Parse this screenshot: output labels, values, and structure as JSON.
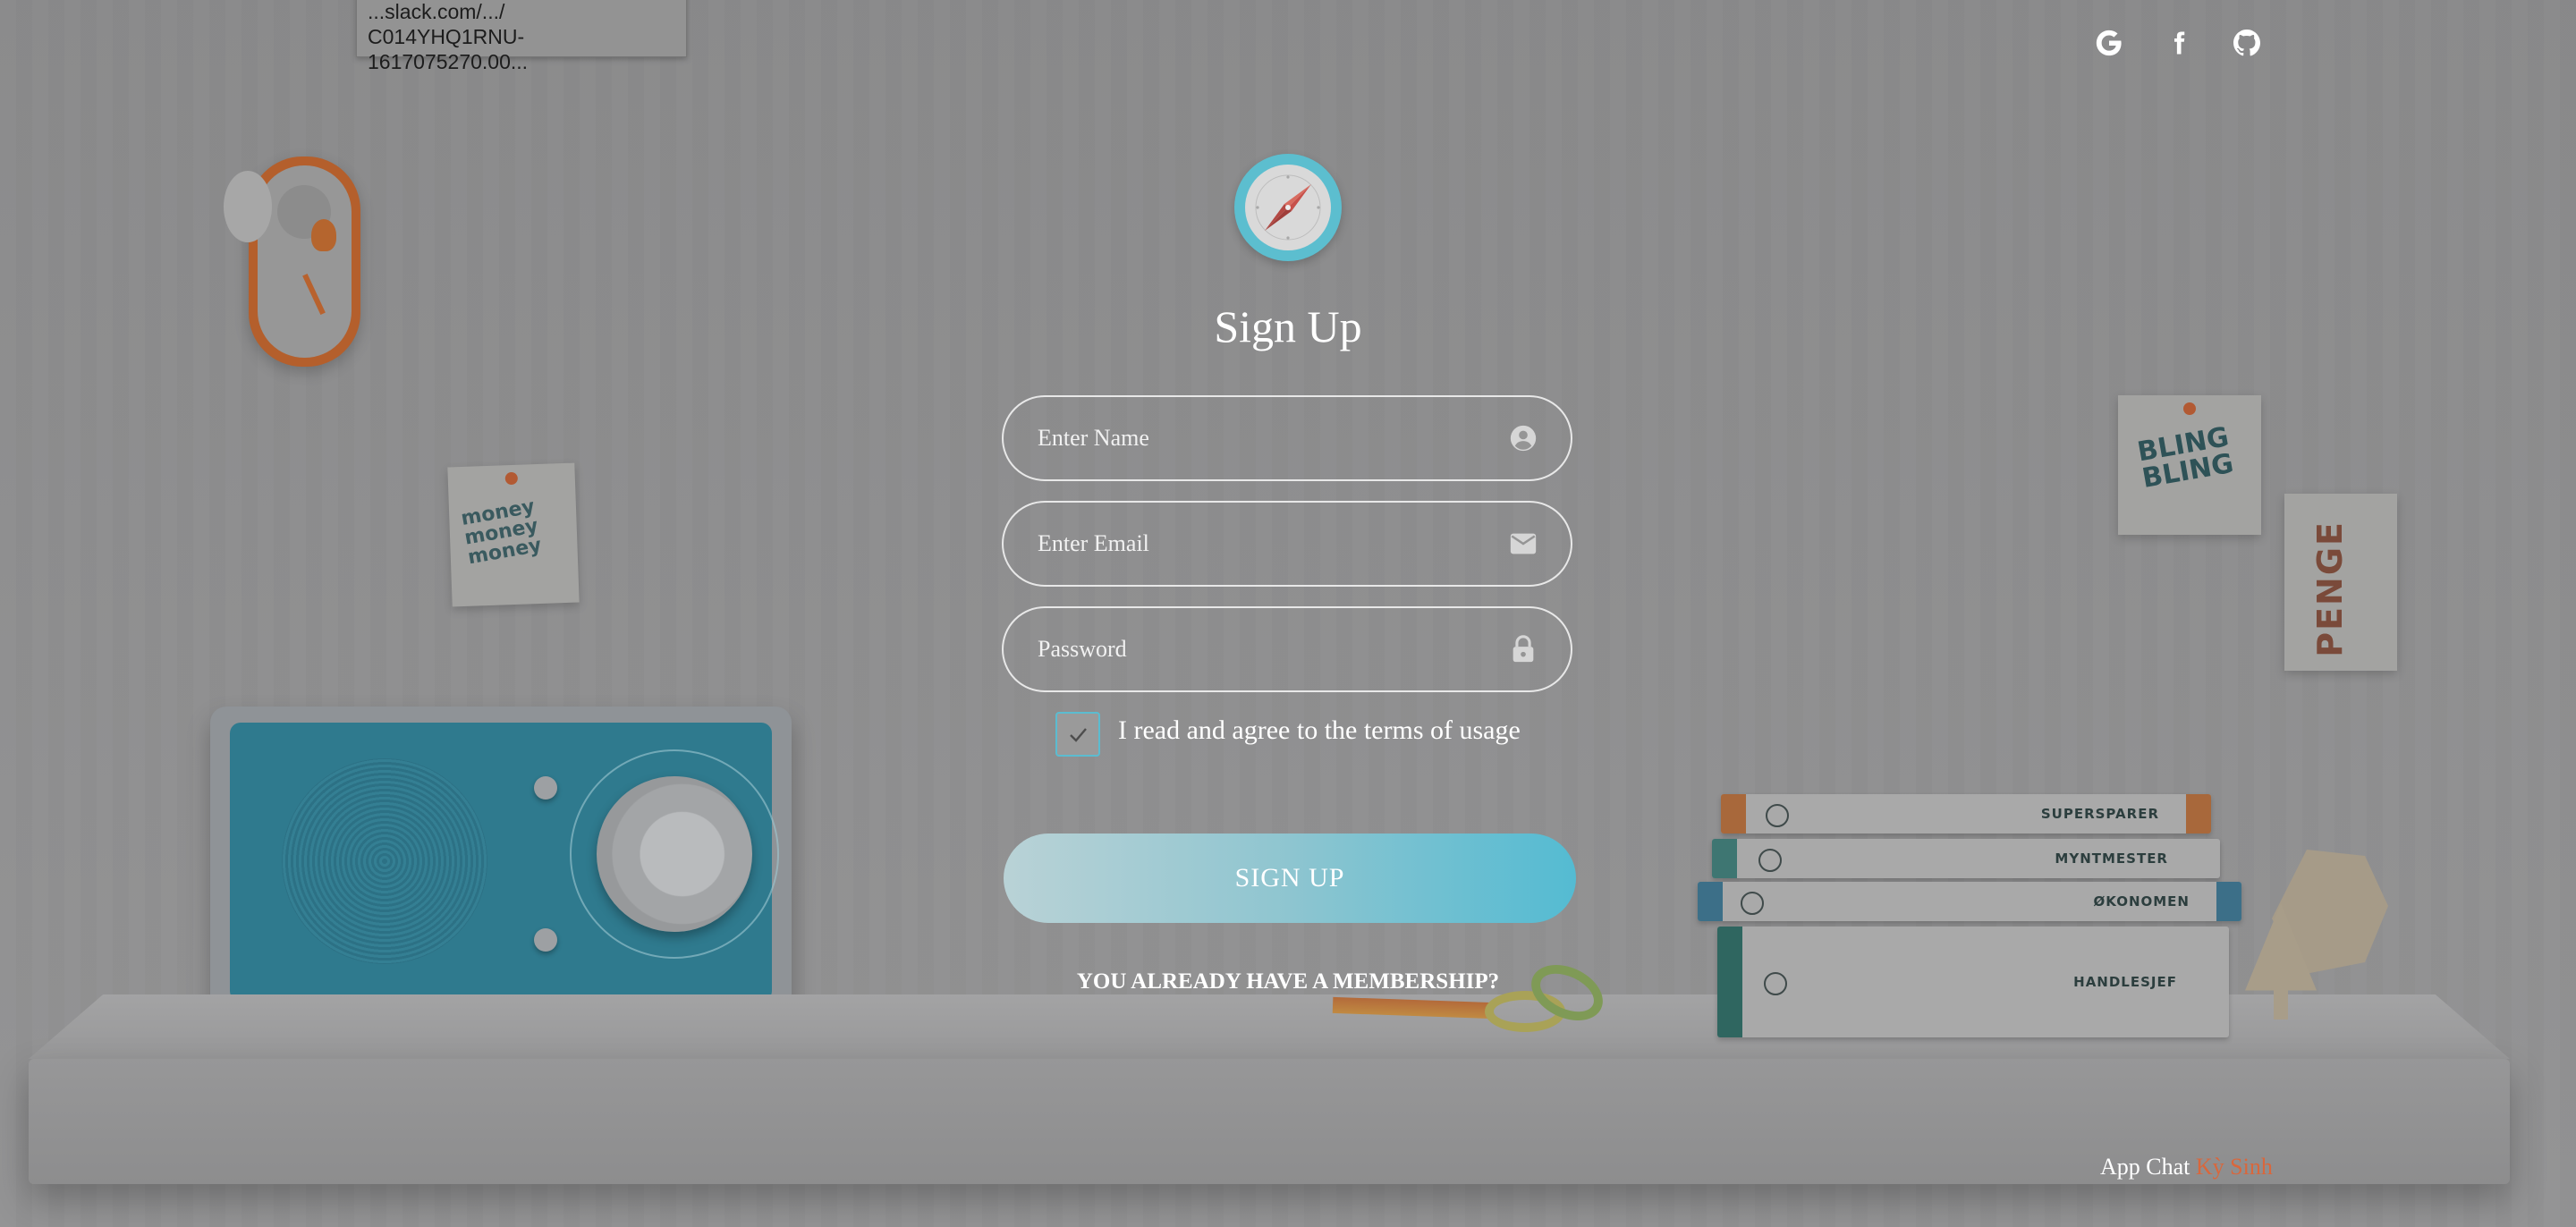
{
  "tooltip": {
    "line1": "...slack.com/.../",
    "line2": "C014YHQ1RNU-1617075270.00..."
  },
  "social": {
    "items": [
      {
        "icon": "google-icon",
        "label": "G"
      },
      {
        "icon": "facebook-icon",
        "label": "f"
      },
      {
        "icon": "github-icon",
        "label": ""
      }
    ]
  },
  "logo": {
    "icon": "compass-icon"
  },
  "form": {
    "title": "Sign Up",
    "name_placeholder": "Enter Name",
    "name_icon": "user-circle-icon",
    "email_placeholder": "Enter Email",
    "email_icon": "envelope-icon",
    "password_placeholder": "Password",
    "password_icon": "lock-icon",
    "terms_label": "I read and agree to the terms of usage",
    "terms_checked": true,
    "submit_label": "SIGN UP",
    "member_link": "YOU ALREADY HAVE A MEMBERSHIP?"
  },
  "decor": {
    "note_money": "money money money",
    "note_bling": "BLING BLING",
    "note_penge": "PENGE",
    "books": [
      "SUPERSPARER",
      "MYNTMESTER",
      "ØKONOMEN",
      "HANDLESJEF"
    ]
  },
  "footer": {
    "prefix": "App Chat ",
    "accent": "Kỳ Sinh"
  },
  "colors": {
    "accent": "#5bbcd0",
    "brand_orange": "#d9673c"
  }
}
